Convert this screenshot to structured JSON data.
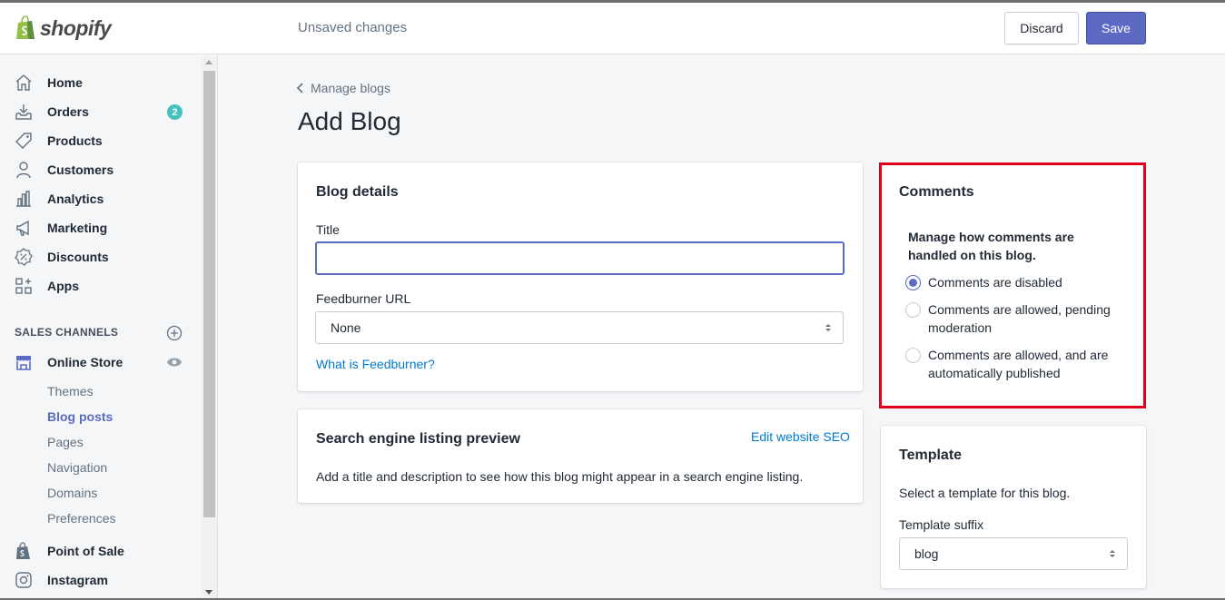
{
  "app": {
    "brand": "shopify"
  },
  "sidebar": {
    "items": [
      {
        "label": "Home",
        "icon": "home-icon"
      },
      {
        "label": "Orders",
        "icon": "orders-icon",
        "badge": "2"
      },
      {
        "label": "Products",
        "icon": "tag-icon"
      },
      {
        "label": "Customers",
        "icon": "person-icon"
      },
      {
        "label": "Analytics",
        "icon": "bar-chart-icon"
      },
      {
        "label": "Marketing",
        "icon": "megaphone-icon"
      },
      {
        "label": "Discounts",
        "icon": "discount-icon"
      },
      {
        "label": "Apps",
        "icon": "apps-icon"
      }
    ],
    "sales_channels_header": "SALES CHANNELS",
    "online_store": {
      "label": "Online Store",
      "subitems": [
        {
          "label": "Themes",
          "active": false
        },
        {
          "label": "Blog posts",
          "active": true
        },
        {
          "label": "Pages",
          "active": false
        },
        {
          "label": "Navigation",
          "active": false
        },
        {
          "label": "Domains",
          "active": false
        },
        {
          "label": "Preferences",
          "active": false
        }
      ]
    },
    "bottom_items": [
      {
        "label": "Point of Sale",
        "icon": "shopify-bag-icon"
      },
      {
        "label": "Instagram",
        "icon": "instagram-icon"
      }
    ]
  },
  "topbar": {
    "status": "Unsaved changes",
    "discard_label": "Discard",
    "save_label": "Save"
  },
  "breadcrumb": {
    "label": "Manage blogs"
  },
  "page": {
    "title": "Add Blog"
  },
  "blog_details": {
    "title": "Blog details",
    "title_label": "Title",
    "title_value": "",
    "feedburner_label": "Feedburner URL",
    "feedburner_value": "None",
    "feedburner_link": "What is Feedburner?"
  },
  "seo": {
    "title": "Search engine listing preview",
    "edit_link": "Edit website SEO",
    "description": "Add a title and description to see how this blog might appear in a search engine listing."
  },
  "comments": {
    "title": "Comments",
    "subtitle": "Manage how comments are handled on this blog.",
    "options": [
      {
        "label": "Comments are disabled",
        "checked": true
      },
      {
        "label": "Comments are allowed, pending moderation",
        "checked": false
      },
      {
        "label": "Comments are allowed, and are automatically published",
        "checked": false
      }
    ]
  },
  "template": {
    "title": "Template",
    "description": "Select a template for this blog.",
    "suffix_label": "Template suffix",
    "suffix_value": "blog"
  },
  "colors": {
    "accent": "#5c6ac4",
    "link": "#007ace",
    "badge": "#47c1bf",
    "highlight": "#e0001b"
  }
}
